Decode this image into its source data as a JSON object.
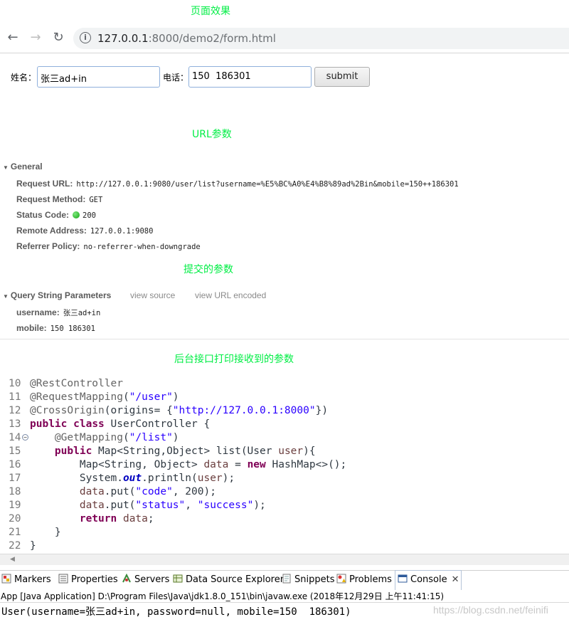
{
  "headings": {
    "page_effect": "页面效果",
    "url_params": "URL参数",
    "submitted_params": "提交的参数",
    "backend_print": "后台接口打印接收到的参数"
  },
  "browser": {
    "url_host": "127.0.0.1",
    "url_rest": ":8000/demo2/form.html"
  },
  "form": {
    "name_label": "姓名：",
    "name_value": "张三ad+in",
    "phone_label": "电话：",
    "phone_value": "150  186301",
    "submit_label": "submit"
  },
  "devtools": {
    "general": {
      "title": "General",
      "rows": [
        {
          "key": "Request URL:",
          "value": "http://127.0.0.1:9080/user/list?username=%E5%BC%A0%E4%B8%89ad%2Bin&mobile=150++186301"
        },
        {
          "key": "Request Method:",
          "value": "GET"
        },
        {
          "key": "Status Code:",
          "value": "200"
        },
        {
          "key": "Remote Address:",
          "value": "127.0.0.1:9080"
        },
        {
          "key": "Referrer Policy:",
          "value": "no-referrer-when-downgrade"
        }
      ]
    },
    "query": {
      "title": "Query String Parameters",
      "view_source": "view source",
      "view_url_encoded": "view URL encoded",
      "rows": [
        {
          "key": "username:",
          "value": "张三ad+in"
        },
        {
          "key": "mobile:",
          "value": "150  186301"
        }
      ]
    }
  },
  "code": {
    "line_numbers": [
      "10",
      "11",
      "12",
      "13",
      "14",
      "15",
      "16",
      "17",
      "18",
      "19",
      "20",
      "21",
      "22"
    ]
  },
  "eclipse": {
    "tabs": [
      "Markers",
      "Properties",
      "Servers",
      "Data Source Explorer",
      "Snippets",
      "Problems",
      "Console"
    ],
    "console_header": "App [Java Application] D:\\Program Files\\Java\\jdk1.8.0_151\\bin\\javaw.exe (2018年12月29日 上午11:41:15)",
    "console_output": "User(username=张三ad+in, password=null, mobile=150  186301)",
    "watermark": "https://blog.csdn.net/feinifi"
  }
}
